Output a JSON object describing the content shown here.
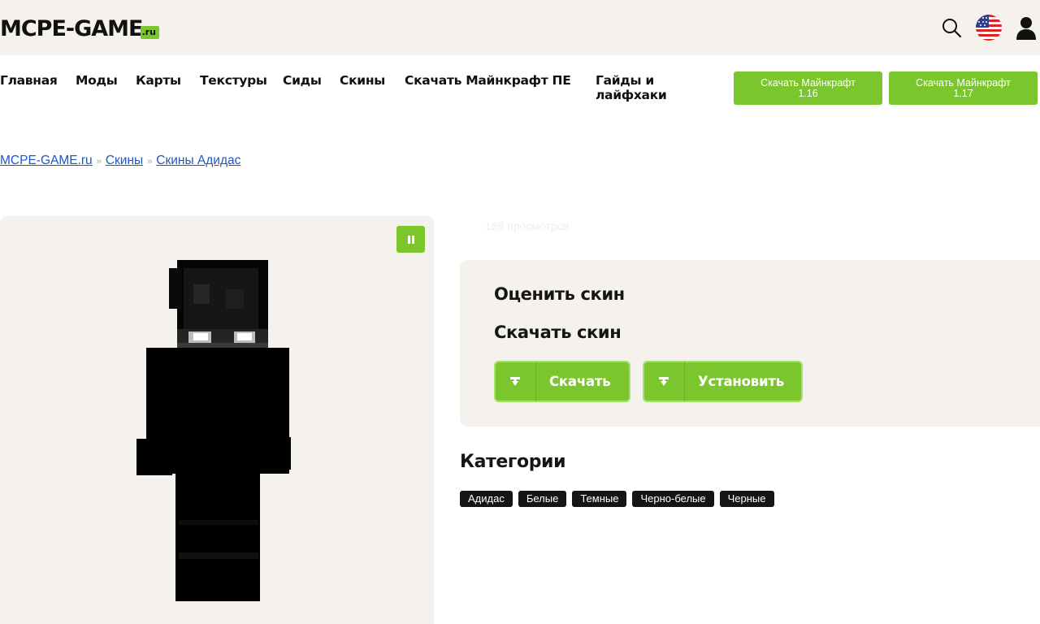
{
  "header": {
    "logo_text": "MCPE-GAME",
    "logo_suffix": ".ru",
    "icons": [
      "search-icon",
      "us-flag-icon",
      "user-icon"
    ]
  },
  "nav": {
    "items": [
      "Главная",
      "Моды",
      "Карты",
      "Текстуры",
      "Сиды",
      "Скины",
      "Скачать Майнкрафт ПЕ",
      "Гайды и лайфхаки"
    ],
    "buttons": [
      {
        "line1": "Скачать Майнкрафт",
        "line2": "1.16"
      },
      {
        "line1": "Скачать Майнкрафт",
        "line2": "1.17"
      }
    ]
  },
  "breadcrumb": {
    "items": [
      "MCPE-GAME.ru",
      "Скины",
      "Скины Адидас"
    ],
    "separator": "»"
  },
  "preview": {
    "pause_icon": "pause-icon"
  },
  "views": "168 просмотров",
  "actions": {
    "rate_heading": "Оценить скин",
    "download_heading": "Скачать скин",
    "download_label": "Скачать",
    "install_label": "Установить"
  },
  "categories": {
    "title": "Категории",
    "tags": [
      "Адидас",
      "Белые",
      "Темные",
      "Черно-белые",
      "Черные"
    ]
  },
  "colors": {
    "accent": "#7bc62d",
    "panel": "#f5f2ee",
    "link": "#1a57c8",
    "tag_bg": "#151515"
  }
}
